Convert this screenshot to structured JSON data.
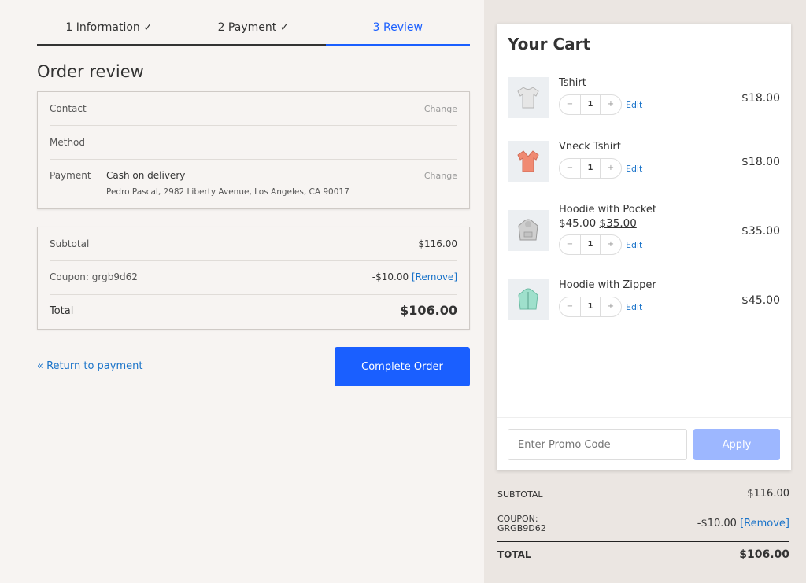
{
  "steps": [
    {
      "label": "1 Information ✓"
    },
    {
      "label": "2 Payment ✓"
    },
    {
      "label": "3 Review"
    }
  ],
  "page_title": "Order review",
  "review": {
    "contact_label": "Contact",
    "method_label": "Method",
    "payment_label": "Payment",
    "payment_value": "Cash on delivery",
    "payment_address": "Pedro Pascal, 2982 Liberty Avenue, Los Angeles, CA 90017",
    "change_label": "Change"
  },
  "totals": {
    "subtotal_label": "Subtotal",
    "subtotal_value": "$116.00",
    "coupon_label": "Coupon: grgb9d62",
    "coupon_value": "-$10.00",
    "remove_label": "[Remove]",
    "total_label": "Total",
    "total_value": "$106.00"
  },
  "actions": {
    "return_label": "« Return to payment",
    "complete_label": "Complete Order"
  },
  "cart": {
    "title": "Your Cart",
    "edit_label": "Edit",
    "items": [
      {
        "name": "Tshirt",
        "qty": "1",
        "price": "$18.00",
        "icon": "tshirt-icon",
        "color": "#e6e6e6"
      },
      {
        "name": "Vneck Tshirt",
        "qty": "1",
        "price": "$18.00",
        "icon": "vneck-tshirt-icon",
        "color": "#f08a72"
      },
      {
        "name": "Hoodie with Pocket",
        "old_price": "$45.00",
        "new_price": "$35.00",
        "qty": "1",
        "price": "$35.00",
        "icon": "hoodie-icon",
        "color": "#cfcfcf"
      },
      {
        "name": "Hoodie with Zipper",
        "qty": "1",
        "price": "$45.00",
        "icon": "zip-hoodie-icon",
        "color": "#9fe0cc"
      }
    ],
    "promo_placeholder": "Enter Promo Code",
    "apply_label": "Apply"
  },
  "summary": {
    "subtotal_label": "SUBTOTAL",
    "subtotal_value": "$116.00",
    "coupon_label_1": "COUPON:",
    "coupon_label_2": "GRGB9D62",
    "coupon_value": "-$10.00",
    "remove_label": "[Remove]",
    "total_label": "TOTAL",
    "total_value": "$106.00"
  },
  "colors": {
    "accent": "#1a5fff",
    "link": "#1a73c9",
    "apply_disabled": "#9db7ff"
  }
}
